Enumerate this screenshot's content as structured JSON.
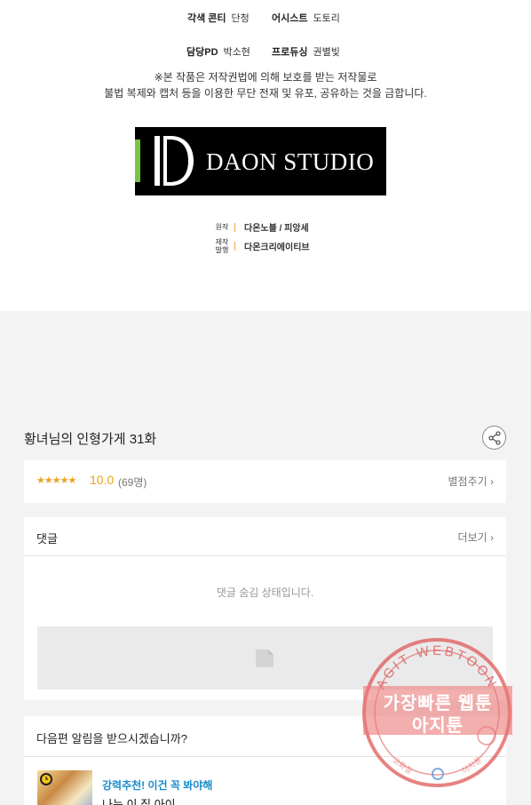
{
  "credits": {
    "lettering_label": "각색 콘티",
    "lettering_value": "단청",
    "assist_label": "어시스트",
    "assist_value": "도토리",
    "pd_label": "담당PD",
    "pd_value": "박소현",
    "producing_label": "프로듀싱",
    "producing_value": "권별빛"
  },
  "notice": {
    "line1": "※본 작품은 저작권법에 의해 보호를 받는 저작물로",
    "line2": "불법 복제와 캡처 등을 이용한 무단 전재 및 유포, 공유하는 것을 금합니다."
  },
  "logo": {
    "text": "DAON STUDIO",
    "accent": "#76c442"
  },
  "origin": {
    "original_label": "원작",
    "original_value": "다온노블 / 피앙세",
    "production_label": "제작 발행",
    "production_value": "다온크리에이티브"
  },
  "episode": {
    "title": "황녀님의 인형가게 31화",
    "share_icon": "share-icon"
  },
  "rating": {
    "stars": "★★★★★",
    "score": "10.0",
    "count": "(69명)",
    "rate_link": "별점주기 ›"
  },
  "comments": {
    "title": "댓글",
    "more": "더보기 ›",
    "hidden_notice": "댓글 숨김 상태입니다."
  },
  "notify": {
    "title": "다음편 알림을 받으시겠습니까?"
  },
  "recommend": {
    "label": "강력추천! 이건 꼭 봐야해",
    "subtitle": "나는 이 집 아이"
  },
  "watermark": {
    "arc": "AGIT WEBTOON",
    "line1": "가장빠른 웹툰",
    "line2": "아지툰",
    "bottom_left": "고화질",
    "bottom_right": "아지툰",
    "color": "#e05858"
  }
}
